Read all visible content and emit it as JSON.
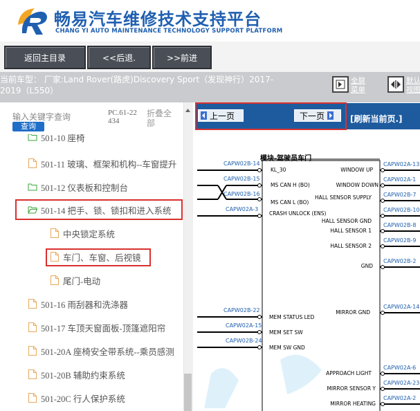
{
  "header": {
    "title": "畅易汽车维修技术支持平台",
    "subtitle": "CHANG YI AUTO MAINTENANCE TECHNOLOGY SUPPORT PLATFORM",
    "brand_color": "#1f5fb0"
  },
  "toolbar": {
    "home_label": "返回主目录",
    "back_label": "<<后退.",
    "forward_label": ">>前进"
  },
  "modelbar": {
    "model_text": "当前车型： 厂家:Land Rover(路虎)Discovery Sport（发现神行）2017-2019（L550）",
    "fullscreen_label": "全屏菜单",
    "default_label": "默认视图"
  },
  "search": {
    "placeholder": "输入关键字查询",
    "button_label": "查询",
    "code": "PC.61-22434",
    "collapse_label": "折叠全部"
  },
  "tree": {
    "items": [
      {
        "label": "501-10 座椅",
        "icon": "folder-open-icon"
      },
      {
        "label": "501-11 玻璃、框架和机构--车窗提升",
        "icon": "page-icon"
      },
      {
        "label": "501-12 仪表板和控制台",
        "icon": "folder-icon"
      },
      {
        "label": "501-14 把手、锁、锁扣和进入系统",
        "icon": "folder-open-icon"
      },
      {
        "label": "中央锁定系统",
        "icon": "page-icon"
      },
      {
        "label": "车门、车窗、后视镜",
        "icon": "page-icon"
      },
      {
        "label": "尾门-电动",
        "icon": "page-icon"
      },
      {
        "label": "501-16 雨刮器和洗涤器",
        "icon": "page-icon"
      },
      {
        "label": "501-17 车顶天窗面板-顶篷遮阳帘",
        "icon": "page-icon"
      },
      {
        "label": "501-20A 座椅安全带系统--乘员感测",
        "icon": "page-icon"
      },
      {
        "label": "501-20B 辅助约束系统",
        "icon": "page-icon"
      },
      {
        "label": "501-20C 行人保护系统",
        "icon": "page-icon"
      }
    ]
  },
  "pager": {
    "prev_label": "上一页",
    "next_label": "下一页",
    "refresh_label": "[刷新当前页.]"
  },
  "diagram": {
    "module_title": "模块-驾驶员车门",
    "left_pins": [
      "CAPW02B-14",
      "CAPW02B-15",
      "CAPW02B-16",
      "CAPW02A-3",
      "CAPW02B-22",
      "CAPW02A-15",
      "CAPW02B-24"
    ],
    "left_signals": [
      "KL_30",
      "MS CAN H (BO)",
      "MS CAN L (BO)",
      "CRASH UNLOCK (ENS)",
      "MEM STATUS LED",
      "MEM SET SW",
      "MEM SW GND"
    ],
    "right_pins": [
      "CAPW02A-13",
      "CAPW02A-1",
      "CAPW02B-7",
      "CAPW02B-10",
      "CAPW02B-8",
      "CAPW02B-9",
      "CAPW02B-2",
      "CAPW02A-14",
      "CAPW02A-6",
      "CAPW02A-23",
      "CAPW02A-2"
    ],
    "right_signals": [
      "WINDOW UP",
      "WINDOW DOWN",
      "HALL SENSOR SUPPLY",
      "HALL SENSOR GND",
      "HALL SENSOR 1",
      "HALL SENSOR 2",
      "GND",
      "MIRROR GND",
      "APPROACH LIGHT",
      "MIRROR SENSOR Y",
      "MIRROR HEATING"
    ]
  },
  "colors": {
    "accent": "#1e5b9e",
    "highlight": "#d9302f",
    "toolbar_button": "#4a4f57"
  }
}
